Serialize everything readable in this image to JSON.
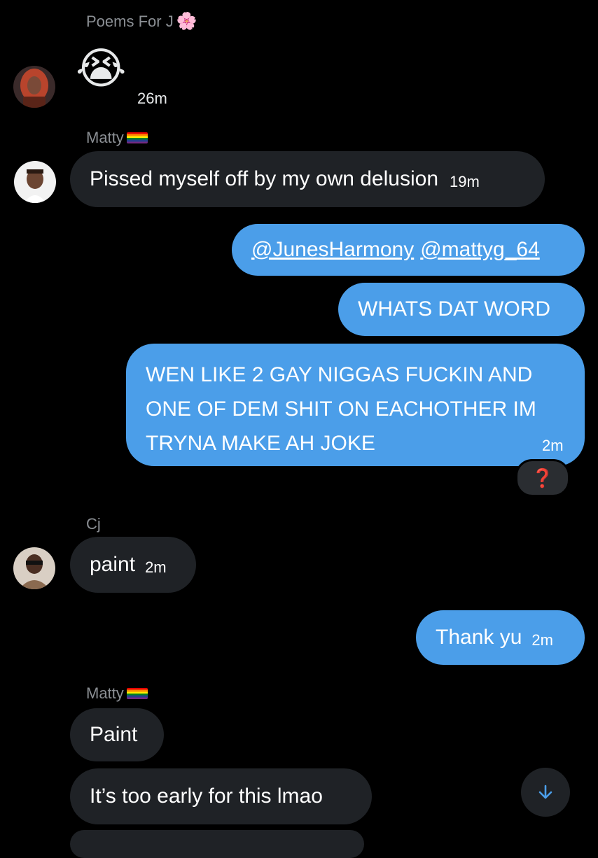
{
  "messages": {
    "group1": {
      "sender": "Poems For J",
      "sender_emoji": "🌸",
      "emoji": "😭",
      "time": "26m"
    },
    "group2": {
      "sender": "Matty",
      "text": "Pissed myself off by my own delusion",
      "time": "19m"
    },
    "outgoing1": {
      "mention1": "@JunesHarmony",
      "mention2": "@mattyg_64"
    },
    "outgoing2": {
      "text": "WHATS DAT WORD"
    },
    "outgoing3": {
      "line1": "WEN LIKE 2 GAY NIGGAS FUCKIN AND",
      "line2": "ONE OF DEM SHIT ON EACHOTHER IM",
      "line3": "TRYNA MAKE AH JOKE",
      "time": "2m",
      "reaction": "❓"
    },
    "group3": {
      "sender": "Cj",
      "text": "paint",
      "time": "2m"
    },
    "outgoing4": {
      "text": "Thank yu",
      "time": "2m"
    },
    "group4": {
      "sender": "Matty",
      "text1": "Paint",
      "text2": "It’s too early for this lmao"
    }
  },
  "icons": {
    "scroll_down": "arrow-down-icon",
    "flag": "rainbow-flag-icon"
  },
  "colors": {
    "background": "#000000",
    "incoming_bubble": "#1f2226",
    "outgoing_bubble": "#4b9ee9",
    "sender_name": "#8b8f94",
    "reaction_red": "#e0162b"
  }
}
